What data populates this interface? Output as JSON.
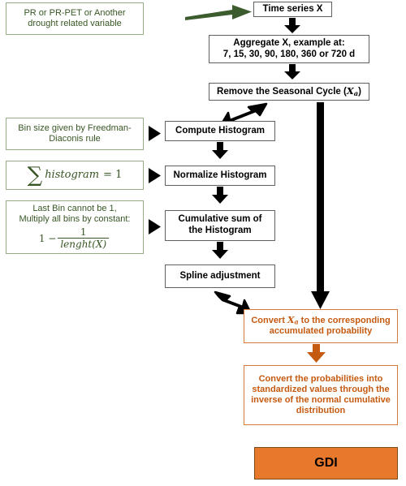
{
  "diagram": {
    "title": "GDI computation flowchart",
    "colors": {
      "green_text": "#375623",
      "green_border": "#94ad86",
      "green_arrow": "#3c5c2e",
      "orange_text": "#c55a11",
      "orange_border": "#d9793a",
      "orange_fill": "#e8792c",
      "black": "#000000",
      "box_border": "#606060"
    }
  },
  "nodes": {
    "source_variable": {
      "line1": "PR or PR-PET or Another",
      "line2": "drought related variable"
    },
    "time_series": {
      "label": "Time series X"
    },
    "aggregate": {
      "line1": "Aggregate X, example at:",
      "line2": "7, 15, 30, 90, 180, 360 or 720 d"
    },
    "remove_seasonal": {
      "prefix": "Remove the Seasonal Cycle (",
      "symbol": "X",
      "subscript": "a",
      "suffix": ")"
    },
    "compute_histogram": {
      "label": "Compute Histogram"
    },
    "normalize_histogram": {
      "label": "Normalize Histogram"
    },
    "cumulative_sum": {
      "line1": "Cumulative sum of",
      "line2": "the Histogram"
    },
    "spline_adjustment": {
      "label": "Spline adjustment"
    },
    "note_bin_size": {
      "line1": "Bin size given by Freedman-",
      "line2": "Diaconis rule"
    },
    "note_sum_histogram": {
      "sigma": "∑",
      "term": "histogram",
      "equals": "= 1"
    },
    "note_last_bin": {
      "line1": "Last Bin cannot be 1,",
      "line2": "Multiply all bins by constant:",
      "formula_lhs": "1 −",
      "formula_numerator": "1",
      "formula_denominator": "lenght(X)"
    },
    "convert_to_probability": {
      "prefix": "Convert ",
      "symbol": "X",
      "subscript": "a",
      "suffix": " to the corresponding",
      "line2": "accumulated probability"
    },
    "convert_to_standardized": {
      "line1": "Convert the probabilities into",
      "line2": "standardized values through the",
      "line3": "inverse of the normal cumulative",
      "line4": "distribution"
    },
    "output_gdi": {
      "label": "GDI"
    }
  },
  "arrows": {
    "source_to_timeseries": "green-arrow-right",
    "timeseries_to_aggregate": "black-arrow-down",
    "aggregate_to_remove": "black-arrow-down",
    "remove_to_compute": "black-arrow-diagonal-down-left",
    "compute_to_normalize": "black-arrow-down",
    "normalize_to_cumulative": "black-arrow-down",
    "cumulative_to_spline": "black-arrow-down",
    "spline_to_convert": "black-arrow-diagonal-down-right",
    "remove_to_convert_long": "black-arrow-long-down",
    "convert_to_standardized": "orange-arrow-down",
    "note_bin_to_compute": "black-triangle-right",
    "note_sum_to_normalize": "black-triangle-right",
    "note_lastbin_to_cumulative": "black-triangle-right"
  }
}
